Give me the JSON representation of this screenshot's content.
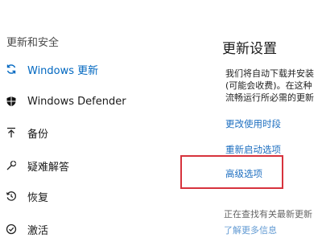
{
  "sidebar": {
    "section_title": "更新和安全",
    "items": [
      {
        "label": "Windows 更新",
        "icon": "refresh-icon",
        "active": true
      },
      {
        "label": "Windows Defender",
        "icon": "shield-icon",
        "active": false
      },
      {
        "label": "备份",
        "icon": "backup-arrow-icon",
        "active": false
      },
      {
        "label": "疑难解答",
        "icon": "wrench-icon",
        "active": false
      },
      {
        "label": "恢复",
        "icon": "history-icon",
        "active": false
      },
      {
        "label": "激活",
        "icon": "check-circle-icon",
        "active": false
      }
    ]
  },
  "main": {
    "title": "更新设置",
    "description_lines": [
      "我们将自动下载并安装",
      "(可能会收费)。在这种",
      "流畅运行所必需的更新"
    ],
    "links": {
      "change_active_hours": "更改使用时段",
      "restart_options": "重新启动选项",
      "advanced_options": "高级选项",
      "learn_more": "了解更多信息"
    },
    "bottom_text": "正在查找有关最新更新"
  },
  "colors": {
    "accent": "#0067c0",
    "link": "#1e6fc0",
    "highlight_border": "#d7333d"
  }
}
